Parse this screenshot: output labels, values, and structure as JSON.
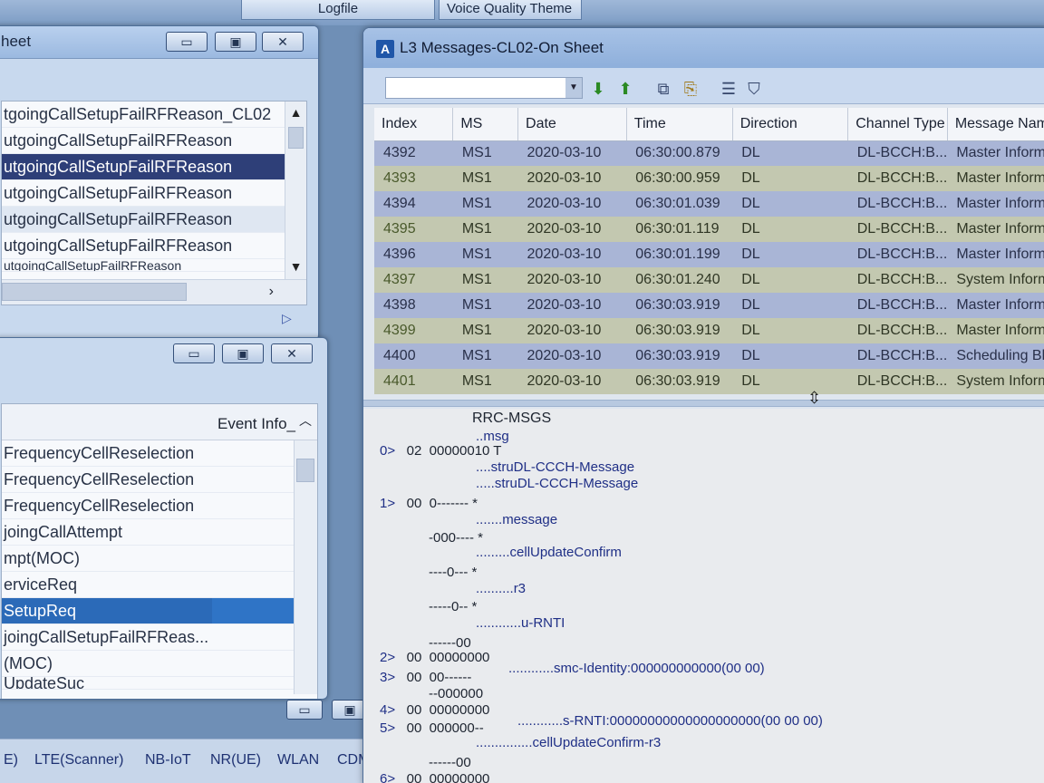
{
  "top_tabs": [
    "Logfile",
    "Voice Quality Theme"
  ],
  "sheet_window": {
    "title": "heet",
    "rows": [
      "tgoingCallSetupFailRFReason_CL02",
      "utgoingCallSetupFailRFReason",
      "utgoingCallSetupFailRFReason",
      "utgoingCallSetupFailRFReason",
      "utgoingCallSetupFailRFReason",
      "utgoingCallSetupFailRFReason",
      "utgoingCallSetupFailRFReason"
    ]
  },
  "event_window": {
    "column_header": "Event Info_",
    "rows": [
      "FrequencyCellReselection",
      "FrequencyCellReselection",
      "FrequencyCellReselection",
      "joingCallAttempt",
      "mpt(MOC)",
      "erviceReq",
      "SetupReq",
      "joingCallSetupFailRFReas...",
      "(MOC)",
      "UpdateSuc"
    ]
  },
  "bottom_tabs": [
    "E)",
    "LTE(Scanner)",
    "NB-IoT",
    "NR(UE)",
    "WLAN",
    "CDM"
  ],
  "l3_window": {
    "title": "L3 Messages-CL02-On Sheet",
    "icon_letter": "A",
    "columns": [
      "Index",
      "MS",
      "Date",
      "Time",
      "Direction",
      "Channel Type",
      "Message Nam"
    ],
    "rows": [
      [
        "4392",
        "MS1",
        "2020-03-10",
        "06:30:00.879",
        "DL",
        "DL-BCCH:B...",
        "Master Inform"
      ],
      [
        "4393",
        "MS1",
        "2020-03-10",
        "06:30:00.959",
        "DL",
        "DL-BCCH:B...",
        "Master Inform"
      ],
      [
        "4394",
        "MS1",
        "2020-03-10",
        "06:30:01.039",
        "DL",
        "DL-BCCH:B...",
        "Master Inform"
      ],
      [
        "4395",
        "MS1",
        "2020-03-10",
        "06:30:01.119",
        "DL",
        "DL-BCCH:B...",
        "Master Inform"
      ],
      [
        "4396",
        "MS1",
        "2020-03-10",
        "06:30:01.199",
        "DL",
        "DL-BCCH:B...",
        "Master Inform"
      ],
      [
        "4397",
        "MS1",
        "2020-03-10",
        "06:30:01.240",
        "DL",
        "DL-BCCH:B...",
        "System Inform"
      ],
      [
        "4398",
        "MS1",
        "2020-03-10",
        "06:30:03.919",
        "DL",
        "DL-BCCH:B...",
        "Master Inform"
      ],
      [
        "4399",
        "MS1",
        "2020-03-10",
        "06:30:03.919",
        "DL",
        "DL-BCCH:B...",
        "Master Inform"
      ],
      [
        "4400",
        "MS1",
        "2020-03-10",
        "06:30:03.919",
        "DL",
        "DL-BCCH:B...",
        "Scheduling Bl"
      ],
      [
        "4401",
        "MS1",
        "2020-03-10",
        "06:30:03.919",
        "DL",
        "DL-BCCH:B...",
        "System Inform"
      ]
    ],
    "decode": {
      "root": "RRC-MSGS",
      "l_msg": "msg",
      "l0": "0>",
      "l0_hex": "02",
      "l0_bits": "00000010 T",
      "l_stru1": "struDL-CCCH-Message",
      "l_stru2": "struDL-CCCH-Message",
      "l1": "1>",
      "l1_hex": "00",
      "l1_bits": "0------- *",
      "l_message": "message",
      "b_000": "-000---- *",
      "l_cuc": "cellUpdateConfirm",
      "b_0a": "----0--- *",
      "l_r3": "r3",
      "b_0b": "-----0-- *",
      "l_urnti": "u-RNTI",
      "b_00": "------00",
      "l2": "2>",
      "l2_hex": "00",
      "l2_bits": "00000000",
      "l_smc": "smc-Identity:000000000000(00 00)",
      "l3": "3>",
      "l3_hex": "00",
      "l3_bits": "00------",
      "b_000000": "--000000",
      "l4": "4>",
      "l4_hex": "00",
      "l4_bits": "00000000",
      "l_srnti": "s-RNTI:00000000000000000000(00 00 00)",
      "l5": "5>",
      "l5_hex": "00",
      "l5_bits": "000000--",
      "l_cucr3": "cellUpdateConfirm-r3",
      "b_00b": "------00",
      "l6": "6>",
      "l6_hex": "00",
      "l6_bits": "00000000"
    }
  }
}
